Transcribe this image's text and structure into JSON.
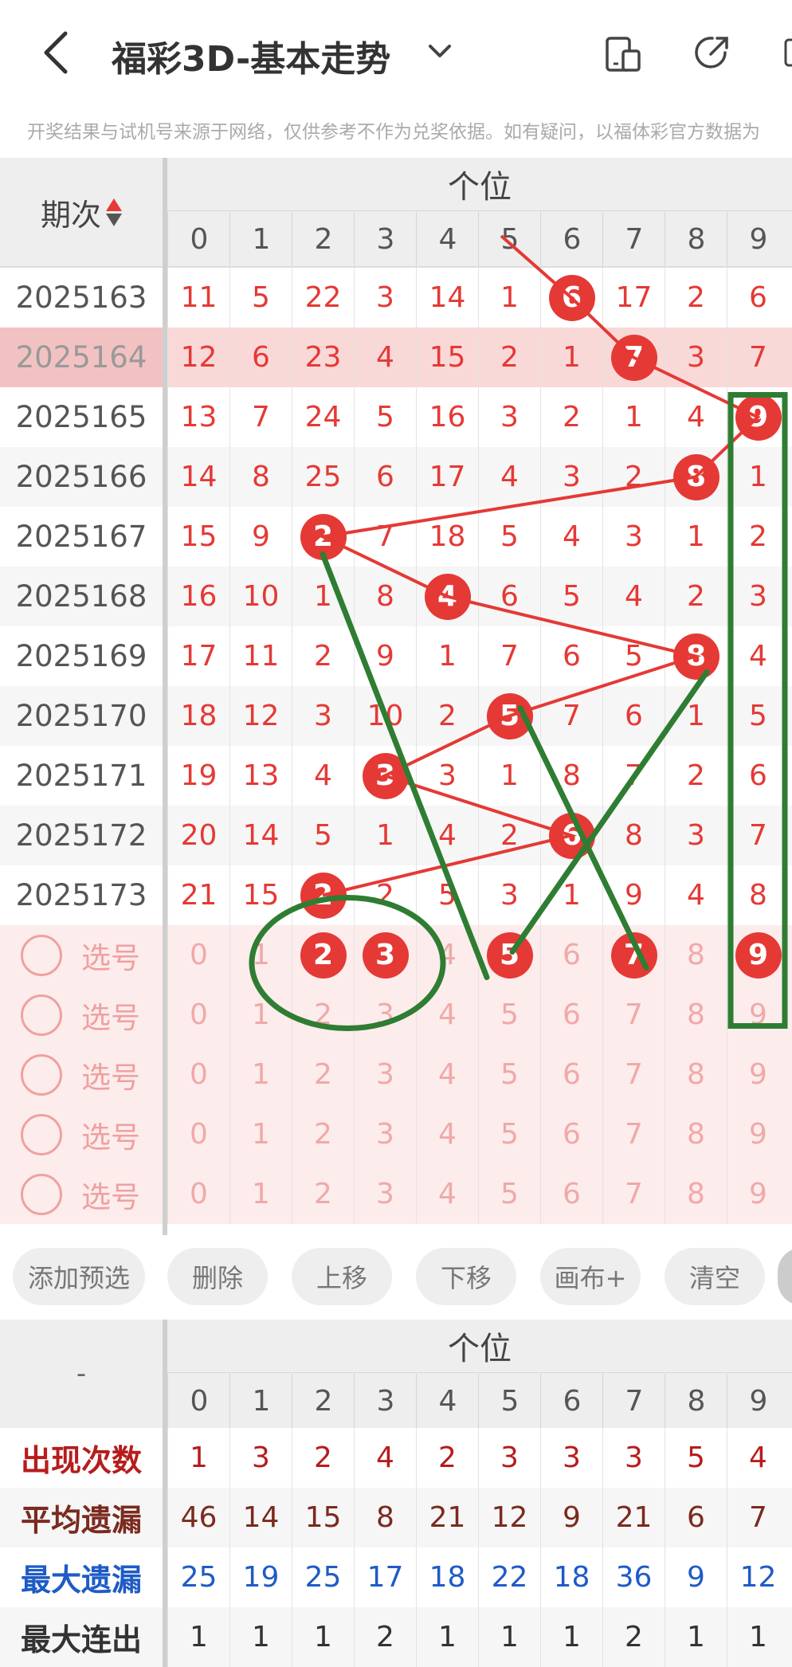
{
  "header": {
    "title": "福彩3D-基本走势",
    "notice": "开奖结果与试机号来源于网络，仅供参考不作为兑奖依据。如有疑问，以福体彩官方数据为"
  },
  "table": {
    "issue_label": "期次",
    "group_title": "个位",
    "digits": [
      "0",
      "1",
      "2",
      "3",
      "4",
      "5",
      "6",
      "7",
      "8",
      "9"
    ],
    "rows": [
      {
        "issue": "2025163",
        "cells": [
          "11",
          "5",
          "22",
          "3",
          "14",
          "1",
          "6",
          "17",
          "2",
          "6"
        ],
        "hit": 6
      },
      {
        "issue": "2025164",
        "cells": [
          "12",
          "6",
          "23",
          "4",
          "15",
          "2",
          "1",
          "7",
          "3",
          "7"
        ],
        "hit": 7
      },
      {
        "issue": "2025165",
        "cells": [
          "13",
          "7",
          "24",
          "5",
          "16",
          "3",
          "2",
          "1",
          "4",
          "9"
        ],
        "hit": 9
      },
      {
        "issue": "2025166",
        "cells": [
          "14",
          "8",
          "25",
          "6",
          "17",
          "4",
          "3",
          "2",
          "8",
          "1"
        ],
        "hit": 8
      },
      {
        "issue": "2025167",
        "cells": [
          "15",
          "9",
          "2",
          "7",
          "18",
          "5",
          "4",
          "3",
          "1",
          "2"
        ],
        "hit": 2
      },
      {
        "issue": "2025168",
        "cells": [
          "16",
          "10",
          "1",
          "8",
          "4",
          "6",
          "5",
          "4",
          "2",
          "3"
        ],
        "hit": 4
      },
      {
        "issue": "2025169",
        "cells": [
          "17",
          "11",
          "2",
          "9",
          "1",
          "7",
          "6",
          "5",
          "8",
          "4"
        ],
        "hit": 8
      },
      {
        "issue": "2025170",
        "cells": [
          "18",
          "12",
          "3",
          "10",
          "2",
          "5",
          "7",
          "6",
          "1",
          "5"
        ],
        "hit": 5
      },
      {
        "issue": "2025171",
        "cells": [
          "19",
          "13",
          "4",
          "3",
          "3",
          "1",
          "8",
          "7",
          "2",
          "6"
        ],
        "hit": 3
      },
      {
        "issue": "2025172",
        "cells": [
          "20",
          "14",
          "5",
          "1",
          "4",
          "2",
          "6",
          "8",
          "3",
          "7"
        ],
        "hit": 6
      },
      {
        "issue": "2025173",
        "cells": [
          "21",
          "15",
          "2",
          "2",
          "5",
          "3",
          "1",
          "9",
          "4",
          "8"
        ],
        "hit": 2
      }
    ],
    "pick_label": "选号",
    "pick_rows": [
      {
        "cells": [
          "0",
          "1",
          "2",
          "3",
          "4",
          "5",
          "6",
          "7",
          "8",
          "9"
        ],
        "picked": [
          2,
          3,
          5,
          7,
          9
        ]
      },
      {
        "cells": [
          "0",
          "1",
          "2",
          "3",
          "4",
          "5",
          "6",
          "7",
          "8",
          "9"
        ],
        "picked": []
      },
      {
        "cells": [
          "0",
          "1",
          "2",
          "3",
          "4",
          "5",
          "6",
          "7",
          "8",
          "9"
        ],
        "picked": []
      },
      {
        "cells": [
          "0",
          "1",
          "2",
          "3",
          "4",
          "5",
          "6",
          "7",
          "8",
          "9"
        ],
        "picked": []
      },
      {
        "cells": [
          "0",
          "1",
          "2",
          "3",
          "4",
          "5",
          "6",
          "7",
          "8",
          "9"
        ],
        "picked": []
      }
    ]
  },
  "buttons": [
    "添加预选",
    "删除",
    "上移",
    "下移",
    "画布+",
    "清空"
  ],
  "stats": {
    "label": "-",
    "group_title": "个位",
    "rows": [
      {
        "label": "出现次数",
        "color": "#b71c1c",
        "values": [
          "1",
          "3",
          "2",
          "4",
          "2",
          "3",
          "3",
          "3",
          "5",
          "4"
        ]
      },
      {
        "label": "平均遗漏",
        "color": "#7b2a1f",
        "values": [
          "46",
          "14",
          "15",
          "8",
          "21",
          "12",
          "9",
          "21",
          "6",
          "7"
        ]
      },
      {
        "label": "最大遗漏",
        "color": "#1e5bc6",
        "values": [
          "25",
          "19",
          "25",
          "17",
          "18",
          "22",
          "18",
          "36",
          "9",
          "12"
        ]
      },
      {
        "label": "最大连出",
        "color": "#333333",
        "values": [
          "1",
          "1",
          "1",
          "2",
          "1",
          "1",
          "1",
          "2",
          "1",
          "1"
        ]
      }
    ]
  },
  "colors": {
    "accent": "#e53935",
    "annotation": "#2e7d32"
  }
}
